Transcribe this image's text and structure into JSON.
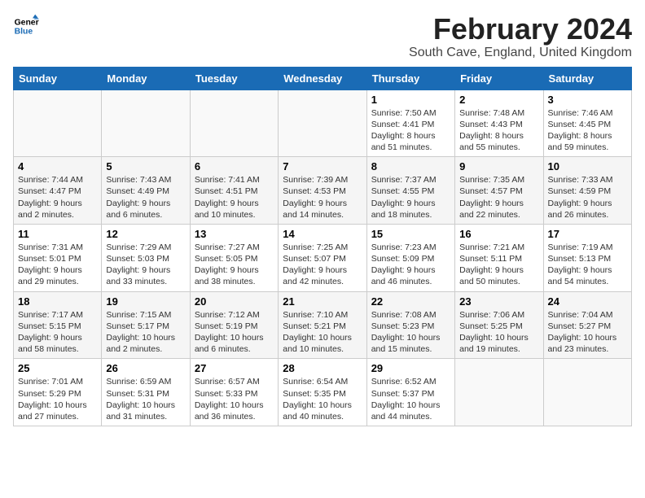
{
  "logo": {
    "line1": "General",
    "line2": "Blue"
  },
  "title": "February 2024",
  "subtitle": "South Cave, England, United Kingdom",
  "days_of_week": [
    "Sunday",
    "Monday",
    "Tuesday",
    "Wednesday",
    "Thursday",
    "Friday",
    "Saturday"
  ],
  "weeks": [
    [
      {
        "day": "",
        "info": ""
      },
      {
        "day": "",
        "info": ""
      },
      {
        "day": "",
        "info": ""
      },
      {
        "day": "",
        "info": ""
      },
      {
        "day": "1",
        "info": "Sunrise: 7:50 AM\nSunset: 4:41 PM\nDaylight: 8 hours\nand 51 minutes."
      },
      {
        "day": "2",
        "info": "Sunrise: 7:48 AM\nSunset: 4:43 PM\nDaylight: 8 hours\nand 55 minutes."
      },
      {
        "day": "3",
        "info": "Sunrise: 7:46 AM\nSunset: 4:45 PM\nDaylight: 8 hours\nand 59 minutes."
      }
    ],
    [
      {
        "day": "4",
        "info": "Sunrise: 7:44 AM\nSunset: 4:47 PM\nDaylight: 9 hours\nand 2 minutes."
      },
      {
        "day": "5",
        "info": "Sunrise: 7:43 AM\nSunset: 4:49 PM\nDaylight: 9 hours\nand 6 minutes."
      },
      {
        "day": "6",
        "info": "Sunrise: 7:41 AM\nSunset: 4:51 PM\nDaylight: 9 hours\nand 10 minutes."
      },
      {
        "day": "7",
        "info": "Sunrise: 7:39 AM\nSunset: 4:53 PM\nDaylight: 9 hours\nand 14 minutes."
      },
      {
        "day": "8",
        "info": "Sunrise: 7:37 AM\nSunset: 4:55 PM\nDaylight: 9 hours\nand 18 minutes."
      },
      {
        "day": "9",
        "info": "Sunrise: 7:35 AM\nSunset: 4:57 PM\nDaylight: 9 hours\nand 22 minutes."
      },
      {
        "day": "10",
        "info": "Sunrise: 7:33 AM\nSunset: 4:59 PM\nDaylight: 9 hours\nand 26 minutes."
      }
    ],
    [
      {
        "day": "11",
        "info": "Sunrise: 7:31 AM\nSunset: 5:01 PM\nDaylight: 9 hours\nand 29 minutes."
      },
      {
        "day": "12",
        "info": "Sunrise: 7:29 AM\nSunset: 5:03 PM\nDaylight: 9 hours\nand 33 minutes."
      },
      {
        "day": "13",
        "info": "Sunrise: 7:27 AM\nSunset: 5:05 PM\nDaylight: 9 hours\nand 38 minutes."
      },
      {
        "day": "14",
        "info": "Sunrise: 7:25 AM\nSunset: 5:07 PM\nDaylight: 9 hours\nand 42 minutes."
      },
      {
        "day": "15",
        "info": "Sunrise: 7:23 AM\nSunset: 5:09 PM\nDaylight: 9 hours\nand 46 minutes."
      },
      {
        "day": "16",
        "info": "Sunrise: 7:21 AM\nSunset: 5:11 PM\nDaylight: 9 hours\nand 50 minutes."
      },
      {
        "day": "17",
        "info": "Sunrise: 7:19 AM\nSunset: 5:13 PM\nDaylight: 9 hours\nand 54 minutes."
      }
    ],
    [
      {
        "day": "18",
        "info": "Sunrise: 7:17 AM\nSunset: 5:15 PM\nDaylight: 9 hours\nand 58 minutes."
      },
      {
        "day": "19",
        "info": "Sunrise: 7:15 AM\nSunset: 5:17 PM\nDaylight: 10 hours\nand 2 minutes."
      },
      {
        "day": "20",
        "info": "Sunrise: 7:12 AM\nSunset: 5:19 PM\nDaylight: 10 hours\nand 6 minutes."
      },
      {
        "day": "21",
        "info": "Sunrise: 7:10 AM\nSunset: 5:21 PM\nDaylight: 10 hours\nand 10 minutes."
      },
      {
        "day": "22",
        "info": "Sunrise: 7:08 AM\nSunset: 5:23 PM\nDaylight: 10 hours\nand 15 minutes."
      },
      {
        "day": "23",
        "info": "Sunrise: 7:06 AM\nSunset: 5:25 PM\nDaylight: 10 hours\nand 19 minutes."
      },
      {
        "day": "24",
        "info": "Sunrise: 7:04 AM\nSunset: 5:27 PM\nDaylight: 10 hours\nand 23 minutes."
      }
    ],
    [
      {
        "day": "25",
        "info": "Sunrise: 7:01 AM\nSunset: 5:29 PM\nDaylight: 10 hours\nand 27 minutes."
      },
      {
        "day": "26",
        "info": "Sunrise: 6:59 AM\nSunset: 5:31 PM\nDaylight: 10 hours\nand 31 minutes."
      },
      {
        "day": "27",
        "info": "Sunrise: 6:57 AM\nSunset: 5:33 PM\nDaylight: 10 hours\nand 36 minutes."
      },
      {
        "day": "28",
        "info": "Sunrise: 6:54 AM\nSunset: 5:35 PM\nDaylight: 10 hours\nand 40 minutes."
      },
      {
        "day": "29",
        "info": "Sunrise: 6:52 AM\nSunset: 5:37 PM\nDaylight: 10 hours\nand 44 minutes."
      },
      {
        "day": "",
        "info": ""
      },
      {
        "day": "",
        "info": ""
      }
    ]
  ]
}
